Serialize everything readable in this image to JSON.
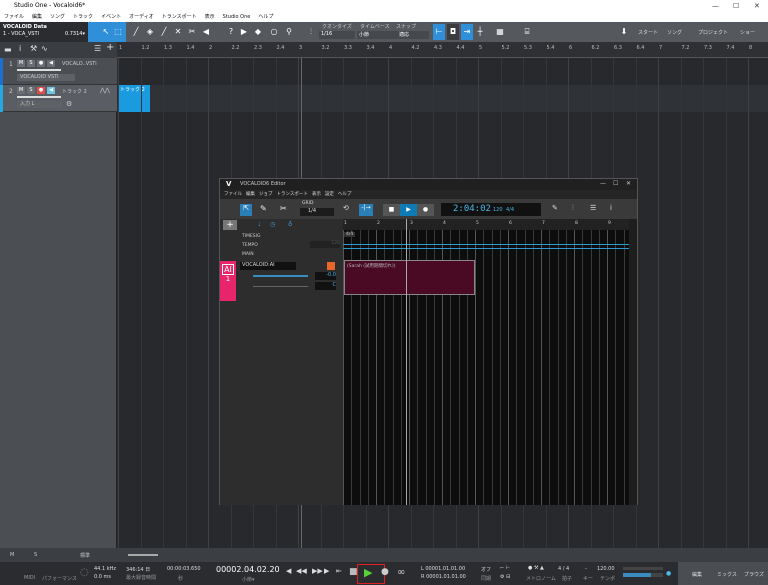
{
  "window": {
    "title": "Studio One - Vocaloid6*",
    "minimize": "—",
    "maximize": "☐",
    "close": "✕"
  },
  "menu": [
    "ファイル",
    "編集",
    "ソング",
    "トラック",
    "イベント",
    "オーディオ",
    "トランスポート",
    "表示",
    "Studio One",
    "ヘルプ"
  ],
  "song": {
    "name": "VOCALOID Data",
    "track": "1 - VOCA_VSTI",
    "cpu": "0.7314▾"
  },
  "toolbar": {
    "quantize_label": "クオンタイズ",
    "quantize_value": "1/16",
    "timebase_label": "タイムベース",
    "timebase_value": "小節",
    "snap_label": "スナップ",
    "snap_value": "適応",
    "start": "スタート",
    "song": "ソング",
    "project": "プロジェクト",
    "show": "ショー",
    "accent": "#2f8fd8"
  },
  "ruler": [
    "1",
    "1.2",
    "1.3",
    "1.4",
    "2",
    "2.2",
    "2.3",
    "2.4",
    "3",
    "3.2",
    "3.3",
    "3.4",
    "4",
    "4.2",
    "4.3",
    "4.4",
    "5",
    "5.2",
    "5.3",
    "5.4",
    "6",
    "6.2",
    "6.3",
    "6.4",
    "7",
    "7.2",
    "7.3",
    "7.4",
    "8"
  ],
  "tracks": [
    {
      "num": "1",
      "name": "VOCALO..VSTi",
      "instrument": "VOCALOID VSTi",
      "m": "M",
      "s": "S"
    },
    {
      "num": "2",
      "name": "トラック 2",
      "input": "入力 L",
      "m": "M",
      "s": "S",
      "clip": "トラック 2"
    }
  ],
  "vocaloid": {
    "title": "VOCALOID6 Editor",
    "logo": "V",
    "menu": [
      "ファイル",
      "編集",
      "ジョブ",
      "トランスポート",
      "表示",
      "設定",
      "ヘルプ"
    ],
    "grid_label": "GRID",
    "grid_value": "1/4",
    "time": "2:04:02",
    "tempo": "120",
    "sig": "4/4",
    "ruler": [
      "1",
      "2",
      "3",
      "4",
      "5",
      "6",
      "7",
      "8",
      "9"
    ],
    "rows": [
      "TIMESIG",
      "TEMPO",
      "MAIN"
    ],
    "tempo_value": "120",
    "timesig_value": "4/4",
    "track": {
      "badge": "AI",
      "num": "1",
      "name": "VOCALOID:AI",
      "vol": "-0.0",
      "pan": "C"
    },
    "part": "(Sarah (試用期間切れ))",
    "part_color": "#4a0a24",
    "badge_color": "#e8246a"
  },
  "bottom": {
    "zoom": "標準",
    "m": "M",
    "s": "S"
  },
  "transport": {
    "midi": "MIDI",
    "performance": "パフォーマンス",
    "rate": "44.1 kHz",
    "latency": "0.0 ms",
    "record_time": "346:14 日",
    "record_label": "最大録音時間",
    "seconds": "00:00:03.650",
    "seconds_label": "秒",
    "position": "00002.04.02.20",
    "position_label": "小節▾",
    "loop_l": "L 00001.01.01.00",
    "loop_r": "R 00001.01.01.00",
    "off": "オフ",
    "sync": "同期",
    "metronome": "メトロノーム",
    "sig": "4 / 4",
    "sig_label": "拍子",
    "key": "-",
    "key_label": "キー",
    "tempo": "120.00",
    "tempo_label": "テンポ",
    "edit": "編集",
    "mix": "ミックス",
    "browse": "ブラウズ",
    "play_color": "#5bd13a",
    "highlight": "#e02020"
  }
}
